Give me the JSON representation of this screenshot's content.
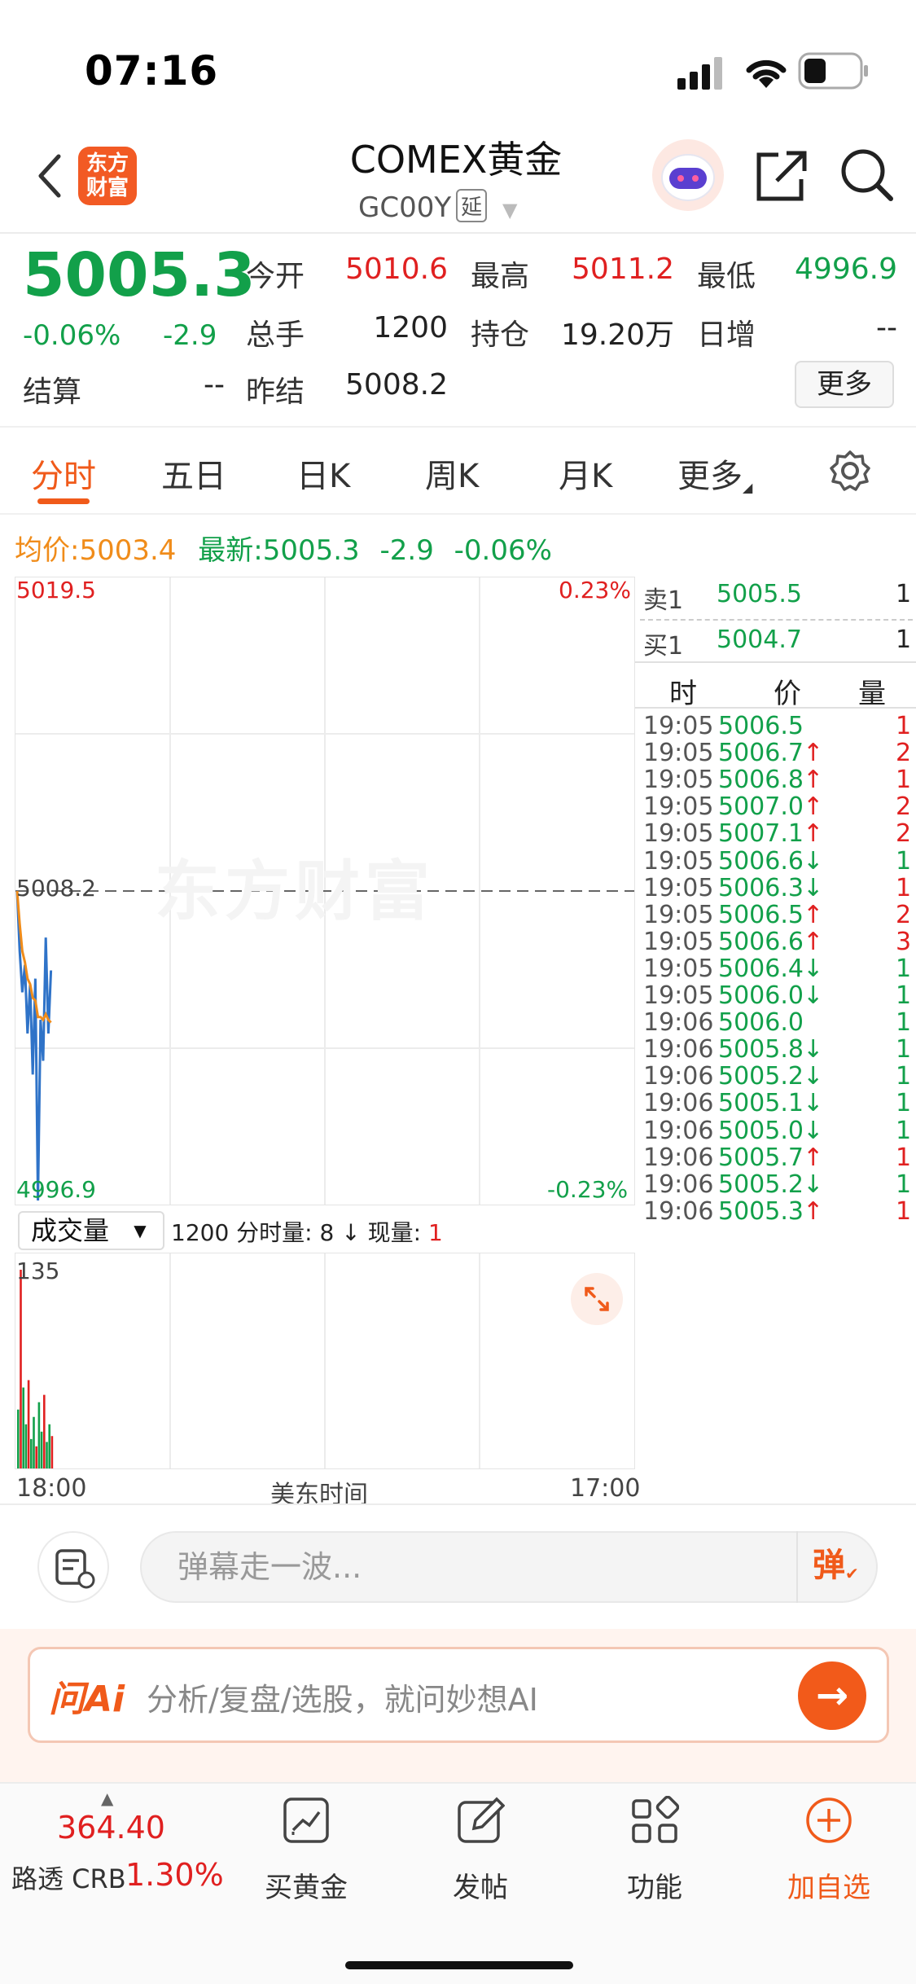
{
  "status_bar": {
    "time": "07:16"
  },
  "nav": {
    "logo_line1": "东方",
    "logo_line2": "财富",
    "title": "COMEX黄金",
    "code": "GC00Y",
    "delay_badge": "延",
    "icons": [
      "back-icon",
      "robot-avatar-icon",
      "share-icon",
      "search-icon"
    ]
  },
  "quote": {
    "price": "5005.3",
    "change_pct": "-0.06%",
    "change": "-2.9",
    "open_label": "今开",
    "open": "5010.6",
    "high_label": "最高",
    "high": "5011.2",
    "low_label": "最低",
    "low": "4996.9",
    "volume_label": "总手",
    "volume": "1200",
    "position_label": "持仓",
    "position": "19.20万",
    "daily_inc_label": "日增",
    "daily_inc": "--",
    "settle_label": "结算",
    "settle": "--",
    "prev_settle_label": "昨结",
    "prev_settle": "5008.2",
    "more_label": "更多"
  },
  "tabs": [
    "分时",
    "五日",
    "日K",
    "周K",
    "月K",
    "更多"
  ],
  "chart_info": {
    "avg_label": "均价:",
    "avg": "5003.4",
    "latest_label": "最新:",
    "latest": "5005.3",
    "latest_change": "-2.9",
    "latest_pct": "-0.06%"
  },
  "chart": {
    "y_top": "5019.5",
    "y_top_pct": "0.23%",
    "y_bottom": "4996.9",
    "y_bottom_pct": "-0.23%",
    "ref_line": "5008.2",
    "watermark": "东方财富",
    "volume_selector": "成交量",
    "volume_info_total": "1200",
    "volume_info_label": "分时量: 8 ↓ 现量:",
    "volume_info_now": "1",
    "volume_max": "135",
    "x_start": "18:00",
    "x_mid": "美东时间",
    "x_end": "17:00"
  },
  "chart_data": {
    "type": "line",
    "series": [
      {
        "values": [
          5008.2,
          5006.0,
          5004.5,
          5005.5,
          5003.0,
          5004.8,
          5001.5,
          5005.0,
          4996.9,
          5003.5,
          5002.0,
          5006.5,
          5003.0,
          5005.3
        ]
      },
      {
        "values": [
          5008.2,
          5007.0,
          5006.0,
          5005.6,
          5005.0,
          5004.8,
          5004.3,
          5004.2,
          5003.6,
          5003.6,
          5003.5,
          5003.7,
          5003.5,
          5003.4
        ]
      }
    ],
    "ylim": [
      4996.9,
      5019.5
    ],
    "volume": [
      40,
      135,
      55,
      30,
      60,
      20,
      35,
      15,
      45,
      25,
      50,
      18,
      30,
      22
    ]
  },
  "orderbook": {
    "ask_label": "卖1",
    "ask_price": "5005.5",
    "ask_qty": "1",
    "bid_label": "买1",
    "bid_price": "5004.7",
    "bid_qty": "1",
    "col_time": "时",
    "col_price": "价",
    "col_qty": "量"
  },
  "ticks": [
    {
      "time": "19:05",
      "price": "5006.5",
      "arrow": "",
      "qty": "1",
      "pc": "green",
      "qc": "red"
    },
    {
      "time": "19:05",
      "price": "5006.7",
      "arrow": "↑",
      "qty": "2",
      "pc": "green",
      "qc": "red"
    },
    {
      "time": "19:05",
      "price": "5006.8",
      "arrow": "↑",
      "qty": "1",
      "pc": "green",
      "qc": "red"
    },
    {
      "time": "19:05",
      "price": "5007.0",
      "arrow": "↑",
      "qty": "2",
      "pc": "green",
      "qc": "red"
    },
    {
      "time": "19:05",
      "price": "5007.1",
      "arrow": "↑",
      "qty": "2",
      "pc": "green",
      "qc": "red"
    },
    {
      "time": "19:05",
      "price": "5006.6",
      "arrow": "↓",
      "qty": "1",
      "pc": "green",
      "qc": "green"
    },
    {
      "time": "19:05",
      "price": "5006.3",
      "arrow": "↓",
      "qty": "1",
      "pc": "green",
      "qc": "red"
    },
    {
      "time": "19:05",
      "price": "5006.5",
      "arrow": "↑",
      "qty": "2",
      "pc": "green",
      "qc": "red"
    },
    {
      "time": "19:05",
      "price": "5006.6",
      "arrow": "↑",
      "qty": "3",
      "pc": "green",
      "qc": "red"
    },
    {
      "time": "19:05",
      "price": "5006.4",
      "arrow": "↓",
      "qty": "1",
      "pc": "green",
      "qc": "green"
    },
    {
      "time": "19:05",
      "price": "5006.0",
      "arrow": "↓",
      "qty": "1",
      "pc": "green",
      "qc": "green"
    },
    {
      "time": "19:06",
      "price": "5006.0",
      "arrow": "",
      "qty": "1",
      "pc": "green",
      "qc": "green"
    },
    {
      "time": "19:06",
      "price": "5005.8",
      "arrow": "↓",
      "qty": "1",
      "pc": "green",
      "qc": "green"
    },
    {
      "time": "19:06",
      "price": "5005.2",
      "arrow": "↓",
      "qty": "1",
      "pc": "green",
      "qc": "green"
    },
    {
      "time": "19:06",
      "price": "5005.1",
      "arrow": "↓",
      "qty": "1",
      "pc": "green",
      "qc": "green"
    },
    {
      "time": "19:06",
      "price": "5005.0",
      "arrow": "↓",
      "qty": "1",
      "pc": "green",
      "qc": "green"
    },
    {
      "time": "19:06",
      "price": "5005.7",
      "arrow": "↑",
      "qty": "1",
      "pc": "green",
      "qc": "red"
    },
    {
      "time": "19:06",
      "price": "5005.2",
      "arrow": "↓",
      "qty": "1",
      "pc": "green",
      "qc": "green"
    },
    {
      "time": "19:06",
      "price": "5005.3",
      "arrow": "↑",
      "qty": "1",
      "pc": "green",
      "qc": "red"
    }
  ],
  "comment": {
    "placeholder": "弹幕走一波...",
    "danmu_label": "弹"
  },
  "ai": {
    "logo": "问Ai",
    "placeholder": "分析/复盘/选股，就问妙想AI"
  },
  "bottom_bar": {
    "index_value": "364.40",
    "index_name": "路透 CRB",
    "index_pct": "1.30%",
    "items": [
      "买黄金",
      "发帖",
      "功能",
      "加自选"
    ]
  },
  "colors": {
    "up": "#e02020",
    "down": "#12a04a",
    "accent": "#f05a1a",
    "avg_line": "#f08c1a",
    "price_line": "#2f73c8"
  }
}
